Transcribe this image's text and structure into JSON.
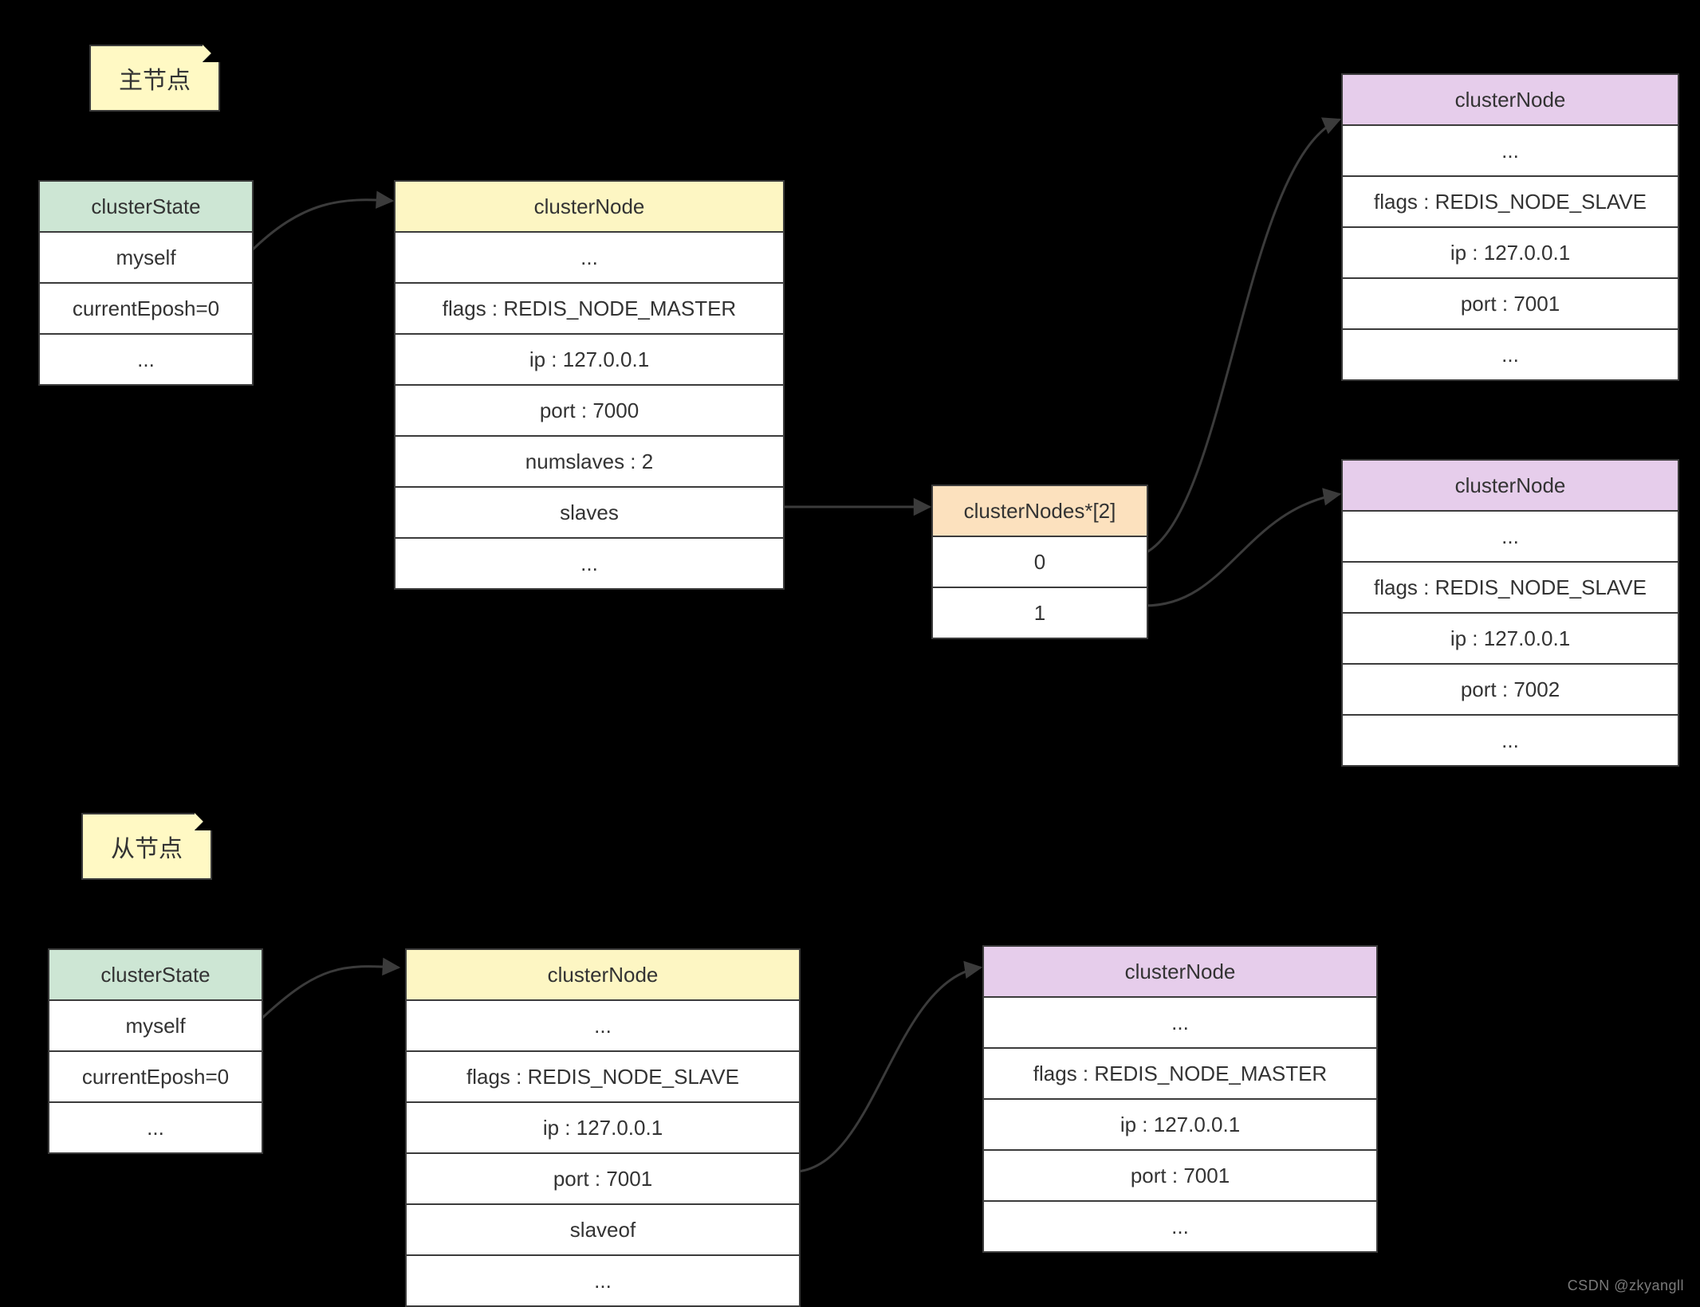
{
  "notes": {
    "master": "主节点",
    "slave": "从节点"
  },
  "upper": {
    "clusterState": {
      "header": "clusterState",
      "rows": [
        "myself",
        "currentEposh=0",
        "..."
      ]
    },
    "masterNode": {
      "header": "clusterNode",
      "rows": [
        "...",
        "flags : REDIS_NODE_MASTER",
        "ip : 127.0.0.1",
        "port : 7000",
        "numslaves : 2",
        "slaves",
        "..."
      ]
    },
    "slavesArray": {
      "header": "clusterNodes*[2]",
      "rows": [
        "0",
        "1"
      ]
    },
    "slaveNodeA": {
      "header": "clusterNode",
      "rows": [
        "...",
        "flags : REDIS_NODE_SLAVE",
        "ip : 127.0.0.1",
        "port : 7001",
        "..."
      ]
    },
    "slaveNodeB": {
      "header": "clusterNode",
      "rows": [
        "...",
        "flags : REDIS_NODE_SLAVE",
        "ip : 127.0.0.1",
        "port : 7002",
        "..."
      ]
    }
  },
  "lower": {
    "clusterState": {
      "header": "clusterState",
      "rows": [
        "myself",
        "currentEposh=0",
        "..."
      ]
    },
    "slaveNode": {
      "header": "clusterNode",
      "rows": [
        "...",
        "flags : REDIS_NODE_SLAVE",
        "ip : 127.0.0.1",
        "port : 7001",
        "slaveof",
        "..."
      ]
    },
    "masterNode": {
      "header": "clusterNode",
      "rows": [
        "...",
        "flags : REDIS_NODE_MASTER",
        "ip : 127.0.0.1",
        "port : 7001",
        "..."
      ]
    }
  },
  "watermark": "CSDN @zkyangll"
}
